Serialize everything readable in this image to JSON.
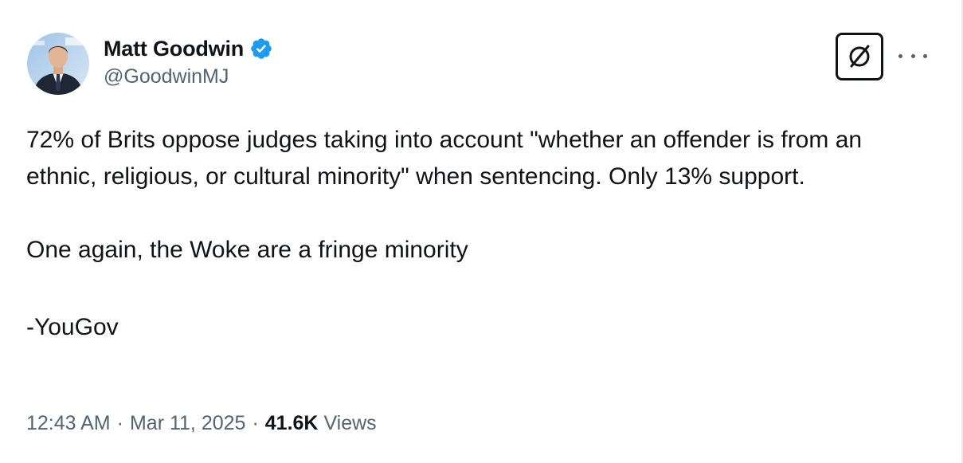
{
  "author": {
    "display_name": "Matt Goodwin",
    "handle": "@GoodwinMJ",
    "verified": true,
    "verified_color": "#1d9bf0"
  },
  "header_actions": {
    "grok_icon": "grok-icon",
    "more_icon": "more-icon"
  },
  "tweet": {
    "paragraphs": [
      "72% of Brits oppose judges taking into account \"whether an offender is from an ethnic, religious, or cultural minority\" when sentencing. Only 13% support.",
      "One again, the Woke are a fringe minority",
      "-YouGov"
    ]
  },
  "meta": {
    "time": "12:43 AM",
    "separator": "·",
    "date": "Mar 11, 2025",
    "views_count": "41.6K",
    "views_label": "Views"
  },
  "colors": {
    "text_primary": "#0f1419",
    "text_secondary": "#536471",
    "border": "#e7e9ea"
  }
}
